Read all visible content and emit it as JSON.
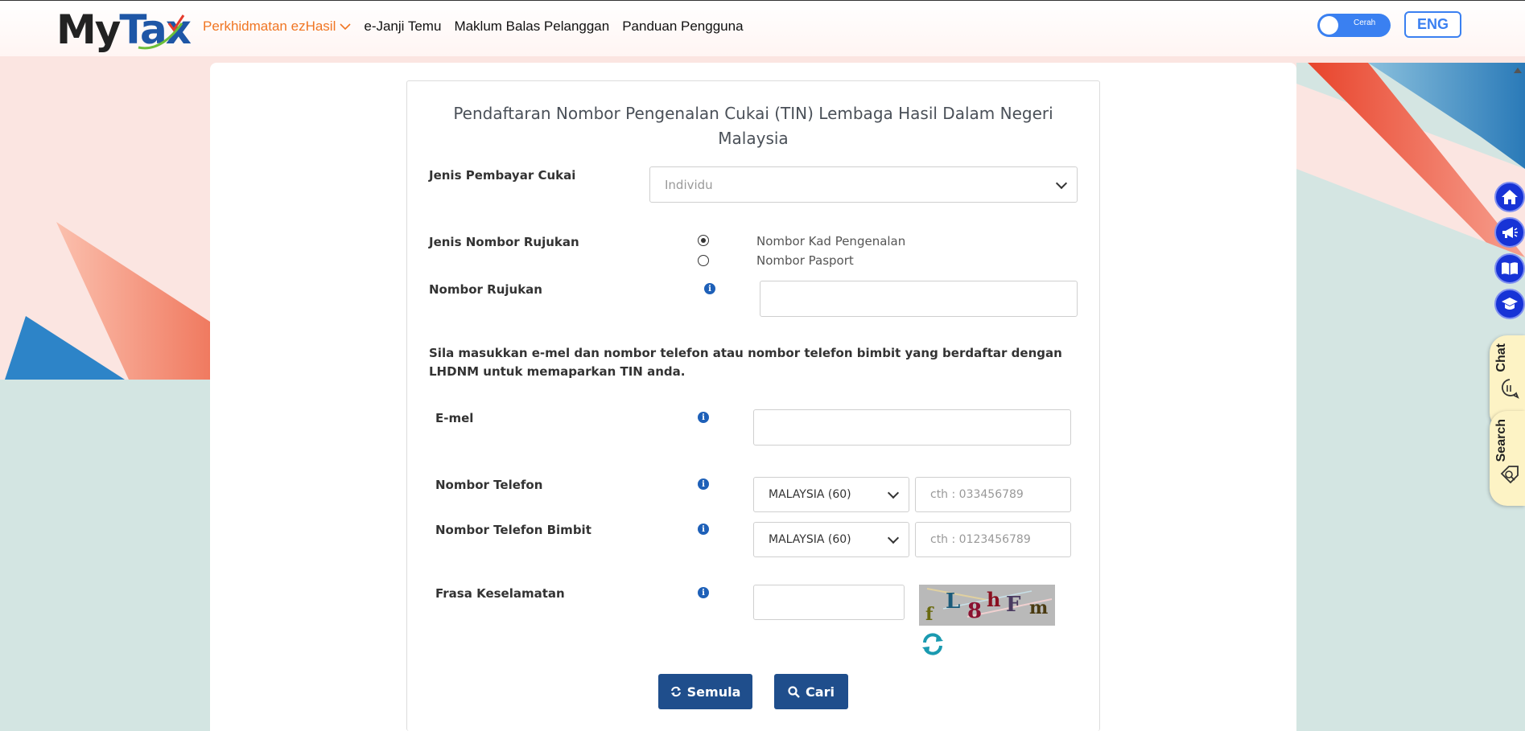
{
  "header": {
    "logo_my": "My",
    "logo_tax": "Tax",
    "nav": [
      {
        "label": "Perkhidmatan ezHasil"
      },
      {
        "label": "e-Janji Temu"
      },
      {
        "label": "Maklum Balas Pelanggan"
      },
      {
        "label": "Panduan Pengguna"
      }
    ],
    "theme_label": "Cerah",
    "lang_label": "ENG"
  },
  "form": {
    "title": "Pendaftaran Nombor Pengenalan Cukai (TIN) Lembaga Hasil Dalam Negeri Malaysia",
    "taxpayer_type_label": "Jenis Pembayar Cukai",
    "taxpayer_type_value": "Individu",
    "ref_type_label": "Jenis Nombor Rujukan",
    "ref_type_options": [
      {
        "label": "Nombor Kad Pengenalan",
        "checked": true
      },
      {
        "label": "Nombor Pasport",
        "checked": false
      }
    ],
    "ref_number_label": "Nombor Rujukan",
    "ref_number_value": "",
    "instruction": "Sila masukkan e-mel dan nombor telefon atau nombor telefon bimbit yang berdaftar dengan LHDNM untuk memaparkan TIN anda.",
    "email_label": "E-mel",
    "email_value": "",
    "phone_label": "Nombor Telefon",
    "phone_country": "MALAYSIA (60)",
    "phone_placeholder": "cth : 033456789",
    "mobile_label": "Nombor Telefon Bimbit",
    "mobile_country": "MALAYSIA (60)",
    "mobile_placeholder": "cth : 0123456789",
    "security_label": "Frasa Keselamatan",
    "security_value": "",
    "captcha_chars": [
      "f",
      "L",
      "8",
      "h",
      "F",
      "m"
    ],
    "reset_label": "Semula",
    "search_label": "Cari"
  },
  "side_tools": {
    "chat_label": "Chat",
    "search_label": "Search",
    "icons": [
      "home-icon",
      "megaphone-icon",
      "book-icon",
      "graduation-cap-icon"
    ]
  },
  "colors": {
    "accent_orange": "#f07624",
    "primary_blue": "#1f4e8c",
    "toggle_blue": "#3a80f1",
    "side_blue": "#1733d6"
  }
}
